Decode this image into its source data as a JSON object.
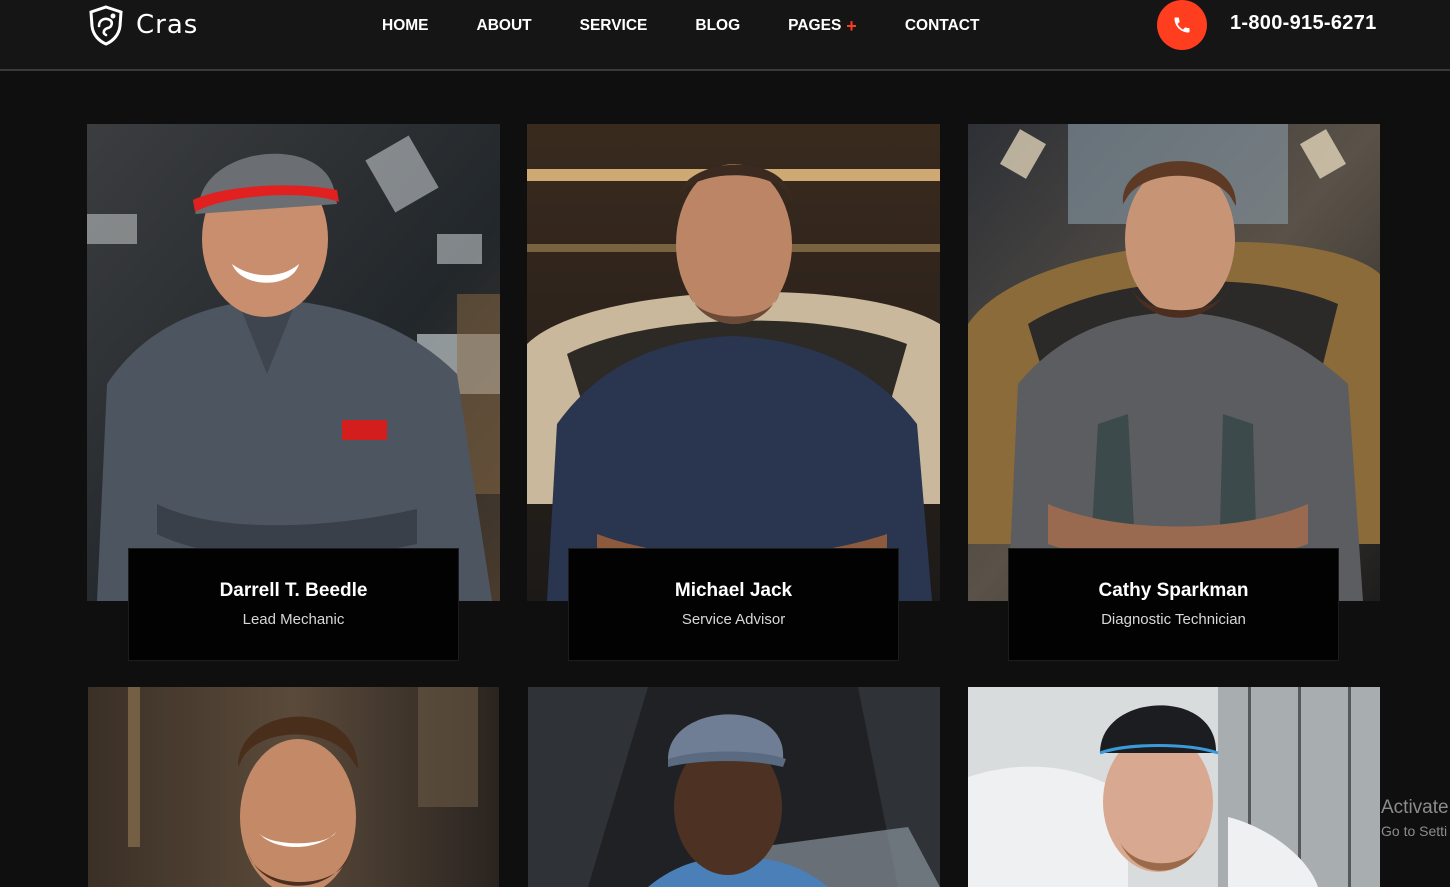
{
  "header": {
    "brand": "Cras",
    "nav": [
      {
        "label": "HOME"
      },
      {
        "label": "ABOUT"
      },
      {
        "label": "SERVICE"
      },
      {
        "label": "BLOG"
      },
      {
        "label": "PAGES",
        "expand": "+"
      },
      {
        "label": "CONTACT"
      }
    ],
    "phone": "1-800-915-6271"
  },
  "team": [
    {
      "name": "Darrell T. Beedle",
      "role": "Lead Mechanic"
    },
    {
      "name": "Michael Jack",
      "role": "Service Advisor"
    },
    {
      "name": "Cathy Sparkman",
      "role": "Diagnostic Technician"
    }
  ],
  "watermark": {
    "title": "Activate",
    "subtitle": "Go to Setti"
  },
  "colors": {
    "accent": "#ff3d1f",
    "background": "#0f0f0f",
    "header": "#161515",
    "card_info": "#020202"
  }
}
